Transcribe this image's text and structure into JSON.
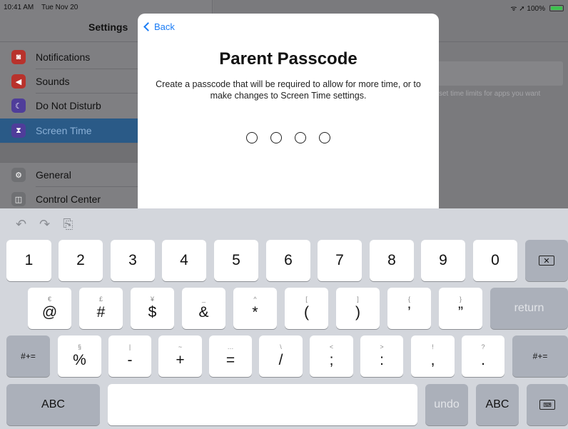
{
  "status": {
    "time": "10:41 AM",
    "date": "Tue Nov 20",
    "right": "ᯤ ➚ 100%"
  },
  "sidebar": {
    "title": "Settings",
    "items": [
      {
        "label": "Notifications",
        "color": "#b8322c",
        "glyph": "◙"
      },
      {
        "label": "Sounds",
        "color": "#b8322c",
        "glyph": "◀"
      },
      {
        "label": "Do Not Disturb",
        "color": "#4f3d9a",
        "glyph": "☾"
      },
      {
        "label": "Screen Time",
        "color": "#4f3d9a",
        "glyph": "⧗"
      },
      {
        "label": "General",
        "color": "#6f7073",
        "glyph": "⚙"
      },
      {
        "label": "Control Center",
        "color": "#6f7073",
        "glyph": "◫"
      }
    ]
  },
  "background": {
    "hint": "set time limits for apps you want"
  },
  "modal": {
    "back": "Back",
    "title": "Parent Passcode",
    "description": "Create a passcode that will be required to allow for more time, or to make changes to Screen Time settings."
  },
  "keyboard": {
    "row1": [
      "1",
      "2",
      "3",
      "4",
      "5",
      "6",
      "7",
      "8",
      "9",
      "0"
    ],
    "row2": [
      {
        "main": "@",
        "sub": "€"
      },
      {
        "main": "#",
        "sub": "£"
      },
      {
        "main": "$",
        "sub": "¥"
      },
      {
        "main": "&",
        "sub": "_"
      },
      {
        "main": "*",
        "sub": "^"
      },
      {
        "main": "(",
        "sub": "["
      },
      {
        "main": ")",
        "sub": "]"
      },
      {
        "main": "’",
        "sub": "{"
      },
      {
        "main": "”",
        "sub": "}"
      }
    ],
    "row3": [
      {
        "main": "%",
        "sub": "§"
      },
      {
        "main": "-",
        "sub": "|"
      },
      {
        "main": "+",
        "sub": "~"
      },
      {
        "main": "=",
        "sub": "…"
      },
      {
        "main": "/",
        "sub": "\\"
      },
      {
        "main": ";",
        "sub": "<"
      },
      {
        "main": ":",
        "sub": ">"
      },
      {
        "main": ",",
        "sub": "!"
      },
      {
        "main": ".",
        "sub": "?"
      }
    ],
    "return": "return",
    "symbols": "#+=",
    "abc": "ABC",
    "undo": "undo"
  }
}
